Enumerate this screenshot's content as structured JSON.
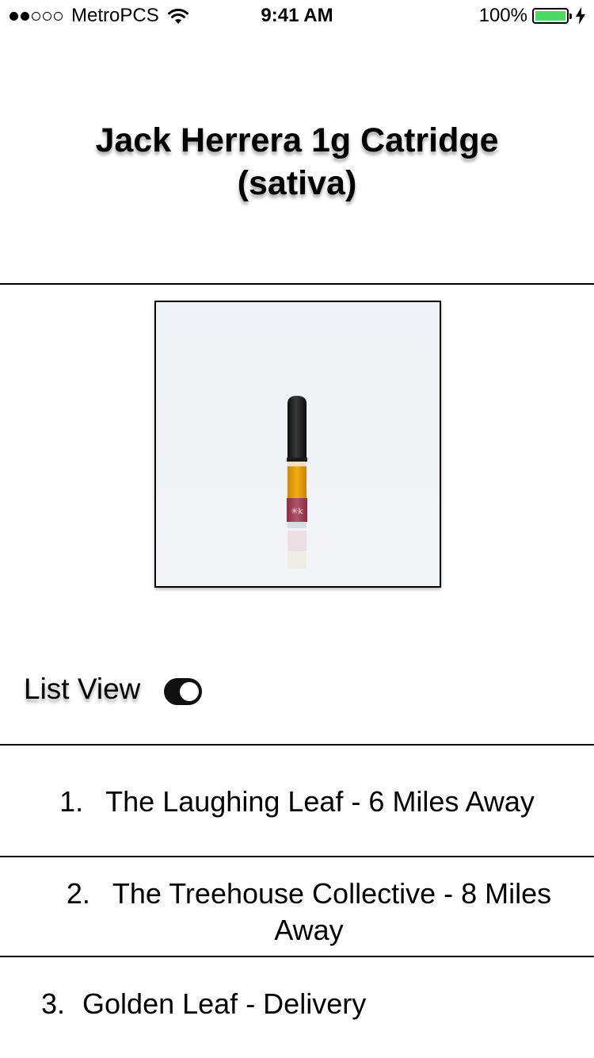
{
  "status_bar": {
    "signal_bars": 2,
    "signal_total": 5,
    "carrier": "MetroPCS",
    "time": "9:41 AM",
    "battery_pct": "100%",
    "battery_color": "#4cd964"
  },
  "product": {
    "title_line1": "Jack Herrera 1g Catridge",
    "title_line2": "(sativa)",
    "image_icon": "vape-cartridge-image"
  },
  "list_view": {
    "label": "List View",
    "toggle_on": true
  },
  "locations": [
    {
      "number": "1.",
      "text": "The Laughing Leaf - 6 Miles Away"
    },
    {
      "number": "2.",
      "text": "The Treehouse Collective - 8 Miles Away"
    },
    {
      "number": "3.",
      "text": "Golden Leaf - Delivery"
    }
  ]
}
